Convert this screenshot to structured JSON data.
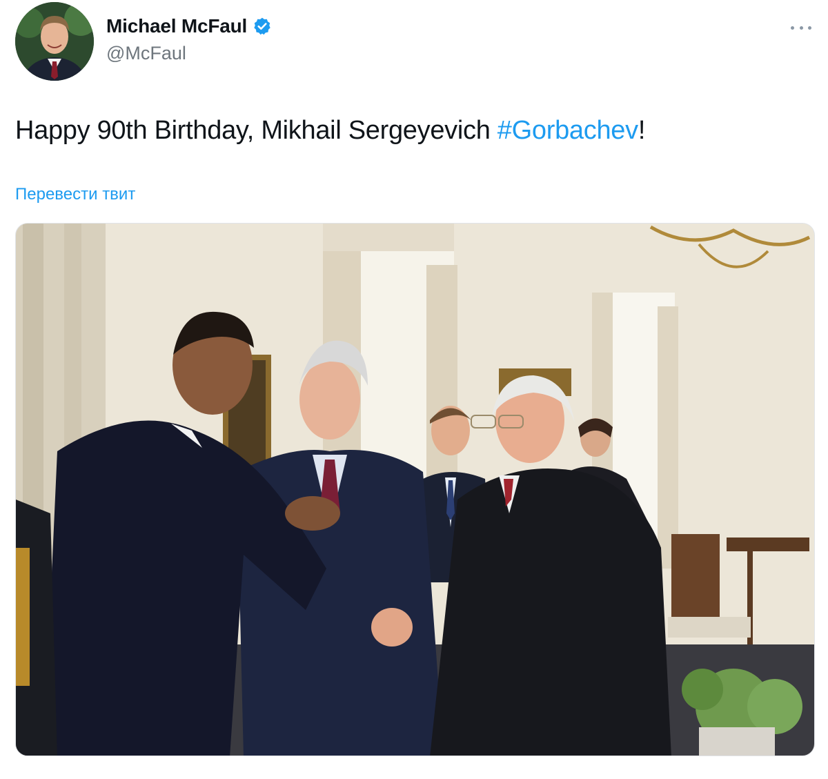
{
  "author": {
    "display_name": "Michael McFaul",
    "handle": "@McFaul",
    "verified": true,
    "avatar_icon": "profile-photo"
  },
  "tweet": {
    "text_before": "Happy 90th Birthday, Mikhail Sergeyevich ",
    "hashtag": "#Gorbachev",
    "text_after": "!",
    "translate_label": "Перевести твит"
  },
  "icons": {
    "verified": "verified-badge-icon",
    "more": "more-options-icon"
  },
  "colors": {
    "link": "#1d9bf0",
    "text": "#0f1419",
    "secondary": "#6e767d"
  }
}
